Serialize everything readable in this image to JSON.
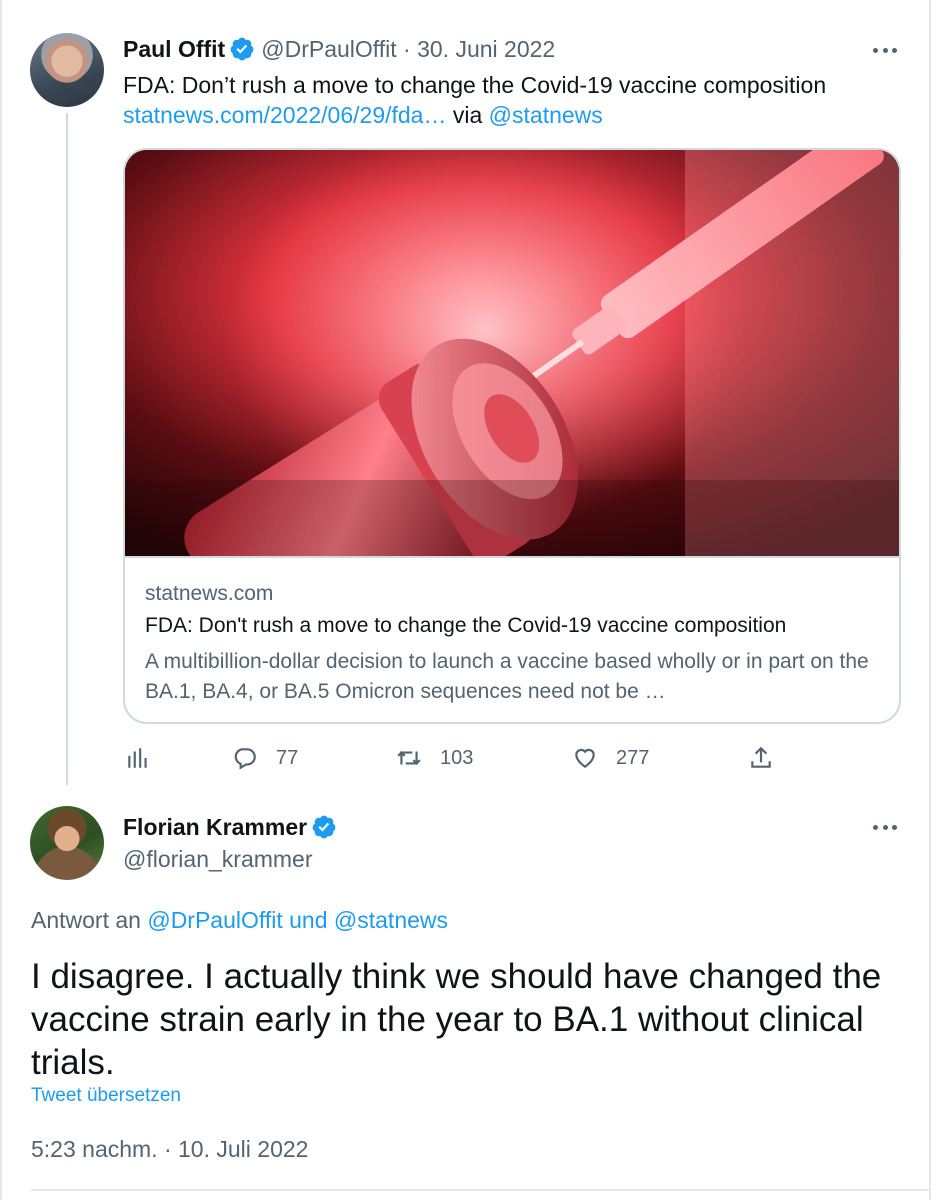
{
  "tweet1": {
    "name": "Paul Offit",
    "handle": "@DrPaulOffit",
    "separator": "·",
    "date": "30. Juni 2022",
    "text": "FDA: Don’t rush a move to change the Covid-19 vaccine composition",
    "link": "statnews.com/2022/06/29/fda…",
    "via_word": "via",
    "via_handle": "@statnews",
    "card": {
      "domain": "statnews.com",
      "title": "FDA: Don't rush a move to change the Covid-19 vaccine composition",
      "description": "A multibillion-dollar decision to launch a vaccine based wholly or in part on the BA.1, BA.4, or BA.5 Omicron sequences need not be …"
    },
    "actions": {
      "replies": "77",
      "retweets": "103",
      "likes": "277"
    }
  },
  "tweet2": {
    "name": "Florian Krammer",
    "handle": "@florian_krammer",
    "reply_prefix": "Antwort an",
    "reply_handle1": "@DrPaulOffit",
    "reply_and": "und",
    "reply_handle2": "@statnews",
    "text": "I disagree. I actually think we should have changed the vaccine strain early in the year to BA.1 without clinical trials.",
    "translate": "Tweet übersetzen",
    "timestamp": "5:23 nachm. · 10. Juli 2022"
  },
  "icons": {
    "verified": "verified-badge-icon",
    "more": "more-dots-icon",
    "analytics": "analytics-icon",
    "reply": "reply-icon",
    "retweet": "retweet-icon",
    "like": "heart-icon",
    "share": "share-icon"
  },
  "colors": {
    "link": "#1d9bf0",
    "text": "#0f1419",
    "muted": "#536471",
    "border": "#cfd9de"
  }
}
